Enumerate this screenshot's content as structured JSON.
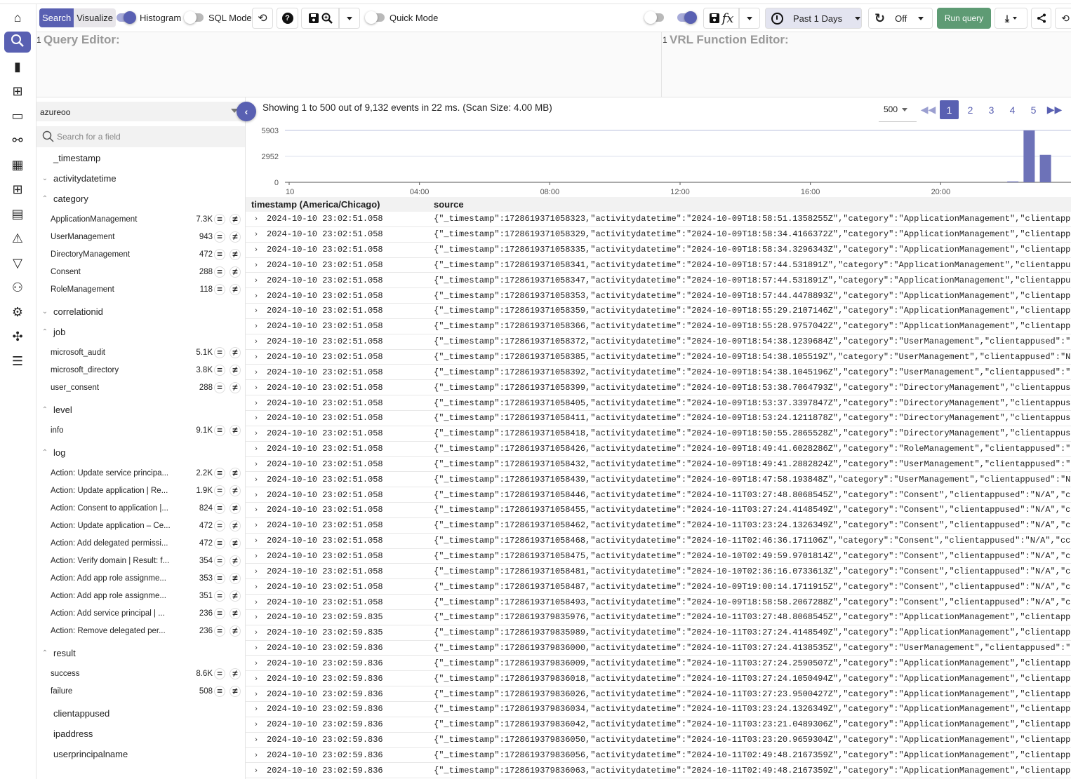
{
  "sidebar": {
    "items": [
      {
        "icon": "home-icon",
        "label": "Home"
      },
      {
        "icon": "search-icon",
        "label": "Logs",
        "active": true
      },
      {
        "icon": "bar-chart-icon",
        "label": "Metrics"
      },
      {
        "icon": "traces-icon",
        "label": "Traces"
      },
      {
        "icon": "devices-icon",
        "label": "RUM"
      },
      {
        "icon": "pipeline-icon",
        "label": "Pipelines"
      },
      {
        "icon": "dashboards-icon",
        "label": "Dashboards"
      },
      {
        "icon": "streams-icon",
        "label": "Streams"
      },
      {
        "icon": "reports-icon",
        "label": "Reports"
      },
      {
        "icon": "alerts-icon",
        "label": "Alerts"
      },
      {
        "icon": "functions-filter-icon",
        "label": "Functions"
      },
      {
        "icon": "iam-icon",
        "label": "IAM"
      },
      {
        "icon": "settings-icon",
        "label": "Settings"
      },
      {
        "icon": "slack-icon",
        "label": "Slack"
      },
      {
        "icon": "list-icon",
        "label": "About"
      }
    ]
  },
  "toolbar": {
    "search_label": "Search",
    "visualize_label": "Visualize",
    "histogram_label": "Histogram",
    "histogram_on": true,
    "sql_mode_label": "SQL Mode",
    "sql_mode_on": false,
    "quick_mode_label": "Quick Mode",
    "quick_mode_on": false,
    "wrap_on": false,
    "function_on": true,
    "time_range": "Past 1 Days",
    "refresh_interval": "Off",
    "run_query_label": "Run query",
    "accent": "#5960b2",
    "run_color": "#5e9b74"
  },
  "editors": {
    "query_line": "1",
    "query_placeholder": "Query Editor:",
    "vrl_line": "1",
    "vrl_placeholder": "VRL Function Editor:"
  },
  "left": {
    "stream": "azureoo",
    "search_placeholder": "Search for a field",
    "fields": [
      {
        "name": "_timestamp",
        "state": "none"
      },
      {
        "name": "activitydatetime",
        "state": "collapsed"
      },
      {
        "name": "category",
        "state": "expanded",
        "values": [
          {
            "v": "ApplicationManagement",
            "c": "7.3K"
          },
          {
            "v": "UserManagement",
            "c": "943"
          },
          {
            "v": "DirectoryManagement",
            "c": "472"
          },
          {
            "v": "Consent",
            "c": "288"
          },
          {
            "v": "RoleManagement",
            "c": "118"
          }
        ]
      },
      {
        "name": "correlationid",
        "state": "collapsed"
      },
      {
        "name": "job",
        "state": "expanded",
        "values": [
          {
            "v": "microsoft_audit",
            "c": "5.1K"
          },
          {
            "v": "microsoft_directory",
            "c": "3.8K"
          },
          {
            "v": "user_consent",
            "c": "288"
          }
        ]
      },
      {
        "name": "level",
        "state": "expanded",
        "values": [
          {
            "v": "info",
            "c": "9.1K"
          }
        ]
      },
      {
        "name": "log",
        "state": "expanded",
        "values": [
          {
            "v": "Action: Update service principa...",
            "c": "2.2K"
          },
          {
            "v": "Action: Update application | Re...",
            "c": "1.9K"
          },
          {
            "v": "Action: Consent to application |...",
            "c": "824"
          },
          {
            "v": "Action: Update application – Ce...",
            "c": "472"
          },
          {
            "v": "Action: Add delegated permissi...",
            "c": "472"
          },
          {
            "v": "Action: Verify domain | Result: f...",
            "c": "354"
          },
          {
            "v": "Action: Add app role assignme...",
            "c": "353"
          },
          {
            "v": "Action: Add app role assignme...",
            "c": "351"
          },
          {
            "v": "Action: Add service principal | ...",
            "c": "236"
          },
          {
            "v": "Action: Remove delegated per...",
            "c": "236"
          }
        ]
      },
      {
        "name": "result",
        "state": "expanded",
        "values": [
          {
            "v": "success",
            "c": "8.6K"
          },
          {
            "v": "failure",
            "c": "508"
          }
        ]
      },
      {
        "name": "clientappused",
        "state": "none"
      },
      {
        "name": "ipaddress",
        "state": "none"
      },
      {
        "name": "userprincipalname",
        "state": "none"
      }
    ]
  },
  "results": {
    "info": "Showing 1 to 500 out of 9,132 events in 22 ms. (Scan Size: 4.00 MB)",
    "page_size": "500",
    "pages": [
      "1",
      "2",
      "3",
      "4",
      "5"
    ],
    "current_page": "1",
    "columns": [
      "timestamp (America/Chicago)",
      "source"
    ],
    "rows": [
      [
        "2024-10-10 23:02:51.058",
        "{\"_timestamp\":1728619371058323,\"activitydatetime\":\"2024-10-09T18:58:51.1358255Z\",\"category\":\"ApplicationManagement\",\"clientapp"
      ],
      [
        "2024-10-10 23:02:51.058",
        "{\"_timestamp\":1728619371058329,\"activitydatetime\":\"2024-10-09T18:58:34.4166372Z\",\"category\":\"ApplicationManagement\",\"clientapp"
      ],
      [
        "2024-10-10 23:02:51.058",
        "{\"_timestamp\":1728619371058335,\"activitydatetime\":\"2024-10-09T18:58:34.3296343Z\",\"category\":\"ApplicationManagement\",\"clientapp"
      ],
      [
        "2024-10-10 23:02:51.058",
        "{\"_timestamp\":1728619371058341,\"activitydatetime\":\"2024-10-09T18:57:44.531891Z\",\"category\":\"ApplicationManagement\",\"clientappu"
      ],
      [
        "2024-10-10 23:02:51.058",
        "{\"_timestamp\":1728619371058347,\"activitydatetime\":\"2024-10-09T18:57:44.531891Z\",\"category\":\"ApplicationManagement\",\"clientappu"
      ],
      [
        "2024-10-10 23:02:51.058",
        "{\"_timestamp\":1728619371058353,\"activitydatetime\":\"2024-10-09T18:57:44.4478893Z\",\"category\":\"ApplicationManagement\",\"clientapp"
      ],
      [
        "2024-10-10 23:02:51.058",
        "{\"_timestamp\":1728619371058359,\"activitydatetime\":\"2024-10-09T18:55:29.2107146Z\",\"category\":\"ApplicationManagement\",\"clientapp"
      ],
      [
        "2024-10-10 23:02:51.058",
        "{\"_timestamp\":1728619371058366,\"activitydatetime\":\"2024-10-09T18:55:28.9757042Z\",\"category\":\"ApplicationManagement\",\"clientapp"
      ],
      [
        "2024-10-10 23:02:51.058",
        "{\"_timestamp\":1728619371058372,\"activitydatetime\":\"2024-10-09T18:54:38.1239684Z\",\"category\":\"UserManagement\",\"clientappused\":\""
      ],
      [
        "2024-10-10 23:02:51.058",
        "{\"_timestamp\":1728619371058385,\"activitydatetime\":\"2024-10-09T18:54:38.105519Z\",\"category\":\"UserManagement\",\"clientappused\":\"N"
      ],
      [
        "2024-10-10 23:02:51.058",
        "{\"_timestamp\":1728619371058392,\"activitydatetime\":\"2024-10-09T18:54:38.1045196Z\",\"category\":\"UserManagement\",\"clientappused\":\""
      ],
      [
        "2024-10-10 23:02:51.058",
        "{\"_timestamp\":1728619371058399,\"activitydatetime\":\"2024-10-09T18:53:38.7064793Z\",\"category\":\"DirectoryManagement\",\"clientappus"
      ],
      [
        "2024-10-10 23:02:51.058",
        "{\"_timestamp\":1728619371058405,\"activitydatetime\":\"2024-10-09T18:53:37.3397847Z\",\"category\":\"DirectoryManagement\",\"clientappus"
      ],
      [
        "2024-10-10 23:02:51.058",
        "{\"_timestamp\":1728619371058411,\"activitydatetime\":\"2024-10-09T18:53:24.1211878Z\",\"category\":\"DirectoryManagement\",\"clientappus"
      ],
      [
        "2024-10-10 23:02:51.058",
        "{\"_timestamp\":1728619371058418,\"activitydatetime\":\"2024-10-09T18:50:55.2865528Z\",\"category\":\"DirectoryManagement\",\"clientappus"
      ],
      [
        "2024-10-10 23:02:51.058",
        "{\"_timestamp\":1728619371058426,\"activitydatetime\":\"2024-10-09T18:49:41.6028286Z\",\"category\":\"RoleManagement\",\"clientappused\":\""
      ],
      [
        "2024-10-10 23:02:51.058",
        "{\"_timestamp\":1728619371058432,\"activitydatetime\":\"2024-10-09T18:49:41.2882824Z\",\"category\":\"UserManagement\",\"clientappused\":\""
      ],
      [
        "2024-10-10 23:02:51.058",
        "{\"_timestamp\":1728619371058439,\"activitydatetime\":\"2024-10-09T18:47:58.193848Z\",\"category\":\"UserManagement\",\"clientappused\":\"N"
      ],
      [
        "2024-10-10 23:02:51.058",
        "{\"_timestamp\":1728619371058446,\"activitydatetime\":\"2024-10-11T03:27:48.8068545Z\",\"category\":\"Consent\",\"clientappused\":\"N/A\",\"c"
      ],
      [
        "2024-10-10 23:02:51.058",
        "{\"_timestamp\":1728619371058455,\"activitydatetime\":\"2024-10-11T03:27:24.4148549Z\",\"category\":\"Consent\",\"clientappused\":\"N/A\",\"c"
      ],
      [
        "2024-10-10 23:02:51.058",
        "{\"_timestamp\":1728619371058462,\"activitydatetime\":\"2024-10-11T03:23:24.1326349Z\",\"category\":\"Consent\",\"clientappused\":\"N/A\",\"c"
      ],
      [
        "2024-10-10 23:02:51.058",
        "{\"_timestamp\":1728619371058468,\"activitydatetime\":\"2024-10-11T02:46:36.171106Z\",\"category\":\"Consent\",\"clientappused\":\"N/A\",\"cc"
      ],
      [
        "2024-10-10 23:02:51.058",
        "{\"_timestamp\":1728619371058475,\"activitydatetime\":\"2024-10-10T02:49:59.9701814Z\",\"category\":\"Consent\",\"clientappused\":\"N/A\",\"c"
      ],
      [
        "2024-10-10 23:02:51.058",
        "{\"_timestamp\":1728619371058481,\"activitydatetime\":\"2024-10-10T02:36:16.0733613Z\",\"category\":\"Consent\",\"clientappused\":\"N/A\",\"c"
      ],
      [
        "2024-10-10 23:02:51.058",
        "{\"_timestamp\":1728619371058487,\"activitydatetime\":\"2024-10-09T19:00:14.1711915Z\",\"category\":\"Consent\",\"clientappused\":\"N/A\",\"c"
      ],
      [
        "2024-10-10 23:02:51.058",
        "{\"_timestamp\":1728619371058493,\"activitydatetime\":\"2024-10-09T18:58:58.2067288Z\",\"category\":\"Consent\",\"clientappused\":\"N/A\",\"c"
      ],
      [
        "2024-10-10 23:02:59.835",
        "{\"_timestamp\":1728619379835976,\"activitydatetime\":\"2024-10-11T03:27:48.8068545Z\",\"category\":\"ApplicationManagement\",\"clientapp"
      ],
      [
        "2024-10-10 23:02:59.835",
        "{\"_timestamp\":1728619379835989,\"activitydatetime\":\"2024-10-11T03:27:24.4148549Z\",\"category\":\"ApplicationManagement\",\"clientapp"
      ],
      [
        "2024-10-10 23:02:59.836",
        "{\"_timestamp\":1728619379836000,\"activitydatetime\":\"2024-10-11T03:27:24.4138535Z\",\"category\":\"UserManagement\",\"clientappused\":\""
      ],
      [
        "2024-10-10 23:02:59.836",
        "{\"_timestamp\":1728619379836009,\"activitydatetime\":\"2024-10-11T03:27:24.2590507Z\",\"category\":\"ApplicationManagement\",\"clientapp"
      ],
      [
        "2024-10-10 23:02:59.836",
        "{\"_timestamp\":1728619379836018,\"activitydatetime\":\"2024-10-11T03:27:24.1050494Z\",\"category\":\"ApplicationManagement\",\"clientapp"
      ],
      [
        "2024-10-10 23:02:59.836",
        "{\"_timestamp\":1728619379836026,\"activitydatetime\":\"2024-10-11T03:27:23.9500427Z\",\"category\":\"ApplicationManagement\",\"clientapp"
      ],
      [
        "2024-10-10 23:02:59.836",
        "{\"_timestamp\":1728619379836034,\"activitydatetime\":\"2024-10-11T03:23:24.1326349Z\",\"category\":\"ApplicationManagement\",\"clientapp"
      ],
      [
        "2024-10-10 23:02:59.836",
        "{\"_timestamp\":1728619379836042,\"activitydatetime\":\"2024-10-11T03:23:21.0489306Z\",\"category\":\"ApplicationManagement\",\"clientapp"
      ],
      [
        "2024-10-10 23:02:59.836",
        "{\"_timestamp\":1728619379836050,\"activitydatetime\":\"2024-10-11T03:23:20.9659304Z\",\"category\":\"ApplicationManagement\",\"clientapp"
      ],
      [
        "2024-10-10 23:02:59.836",
        "{\"_timestamp\":1728619379836056,\"activitydatetime\":\"2024-10-11T02:49:48.2167359Z\",\"category\":\"ApplicationManagement\",\"clientapp"
      ],
      [
        "2024-10-10 23:02:59.836",
        "{\"_timestamp\":1728619379836063,\"activitydatetime\":\"2024-10-11T02:49:48.2167359Z\",\"category\":\"ApplicationManagement\",\"clientapp"
      ]
    ]
  },
  "chart_data": {
    "type": "bar",
    "title": "",
    "xlabel": "",
    "ylabel": "",
    "x_tick_labels": [
      "10",
      "04:00",
      "08:00",
      "12:00",
      "16:00",
      "20:00"
    ],
    "x_tick_hours": [
      0,
      4,
      8,
      12,
      16,
      20
    ],
    "xlim_hours": [
      0,
      24
    ],
    "y_ticks": [
      0,
      2952,
      5903
    ],
    "ylim": [
      0,
      5903
    ],
    "grid": true,
    "bars": [
      {
        "x": "22:00",
        "hour": 22.0,
        "value": 100
      },
      {
        "x": "22:30",
        "hour": 22.5,
        "value": 5903
      },
      {
        "x": "23:00",
        "hour": 23.0,
        "value": 3129
      }
    ],
    "color": "#6d72b8"
  }
}
